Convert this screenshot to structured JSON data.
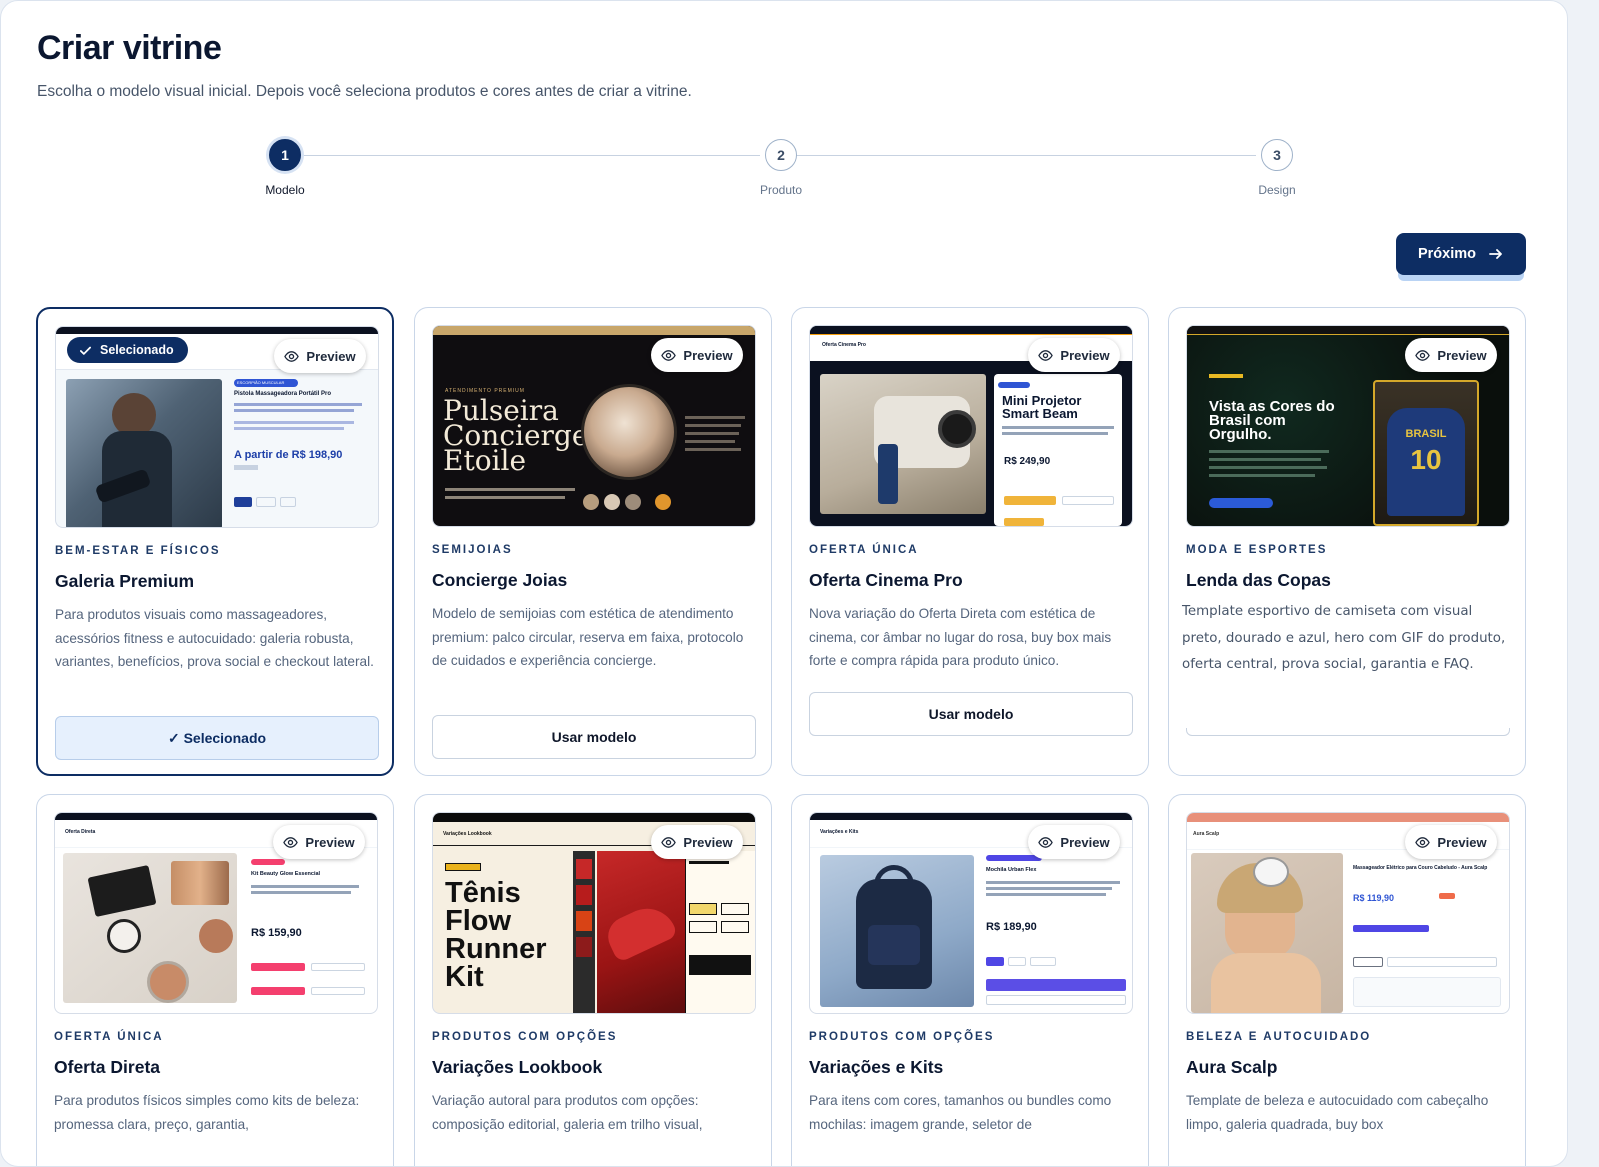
{
  "header": {
    "title": "Criar vitrine",
    "subtitle": "Escolha o modelo visual inicial. Depois você seleciona produtos e cores antes de criar a vitrine."
  },
  "stepper": {
    "steps": [
      {
        "number": "1",
        "label": "Modelo",
        "active": true
      },
      {
        "number": "2",
        "label": "Produto",
        "active": false
      },
      {
        "number": "3",
        "label": "Design",
        "active": false
      }
    ]
  },
  "next_button": {
    "label": "Próximo"
  },
  "preview_label": "Preview",
  "selected_badge": "Selecionado",
  "templates": [
    {
      "category": "BEM-ESTAR E FÍSICOS",
      "name": "Galeria Premium",
      "description": "Para produtos visuais como massageadores, acessórios fitness e autocuidado: galeria robusta, variantes, benefícios, prova social e checkout lateral.",
      "button": "✓ Selecionado",
      "selected": true,
      "thumb": {
        "headline": "Pistola Massageadora Portátil Pro",
        "price": "A partir de R$ 198,90",
        "badge": "ESCORPIÃO MUSCULAR"
      }
    },
    {
      "category": "SEMIJOIAS",
      "name": "Concierge Joias",
      "description": "Modelo de semijoias com estética de atendimento premium: palco circular, reserva em faixa, protocolo de cuidados e experiência concierge.",
      "button": "Usar modelo",
      "selected": false,
      "thumb": {
        "headline_1": "Pulseira",
        "headline_2": "Concierge",
        "headline_3": "Etoile",
        "kicker": "ATENDIMENTO PREMIUM"
      }
    },
    {
      "category": "OFERTA ÚNICA",
      "name": "Oferta Cinema Pro",
      "description": "Nova variação do Oferta Direta com estética de cinema, cor âmbar no lugar do rosa, buy box mais forte e compra rápida para produto único.",
      "button": "Usar modelo",
      "selected": false,
      "thumb": {
        "headline": "Mini Projetor Smart Beam",
        "price": "R$ 249,90",
        "brand": "Oferta Cinema Pro"
      }
    },
    {
      "category": "MODA E ESPORTES",
      "name": "Lenda das Copas",
      "description": "Template esportivo de camiseta com visual preto, dourado e azul, hero com GIF do produto, oferta central, prova social, garantia e FAQ.",
      "button": "",
      "selected": false,
      "thumb": {
        "headline": "Vista as Cores do Brasil com Orgulho.",
        "shirt": "BRASIL",
        "shirt_num": "10"
      }
    },
    {
      "category": "OFERTA ÚNICA",
      "name": "Oferta Direta",
      "description": "Para produtos físicos simples como kits de beleza: promessa clara, preço, garantia,",
      "button": "",
      "selected": false,
      "thumb": {
        "headline": "Kit Beauty Glow Essencial",
        "price": "R$ 159,90",
        "brand": "Oferta Direta"
      }
    },
    {
      "category": "PRODUTOS COM OPÇÕES",
      "name": "Variações Lookbook",
      "description": "Variação autoral para produtos com opções: composição editorial, galeria em trilho visual,",
      "button": "",
      "selected": false,
      "thumb": {
        "headline_1": "Tênis",
        "headline_2": "Flow",
        "headline_3": "Runner",
        "headline_4": "Kit",
        "brand": "Variações Lookbook"
      }
    },
    {
      "category": "PRODUTOS COM OPÇÕES",
      "name": "Variações e Kits",
      "description": "Para itens com cores, tamanhos ou bundles como mochilas: imagem grande, seletor de",
      "button": "",
      "selected": false,
      "thumb": {
        "headline": "Mochila Urban Flex",
        "price": "R$ 189,90",
        "brand": "Variações e Kits"
      }
    },
    {
      "category": "BELEZA E AUTOCUIDADO",
      "name": "Aura Scalp",
      "description": "Template de beleza e autocuidado com cabeçalho limpo, galeria quadrada, buy box",
      "button": "",
      "selected": false,
      "thumb": {
        "headline": "Massageador Elétrico para Couro Cabeludo - Aura Scalp",
        "price": "R$ 119,90",
        "brand": "Aura Scalp"
      }
    }
  ]
}
